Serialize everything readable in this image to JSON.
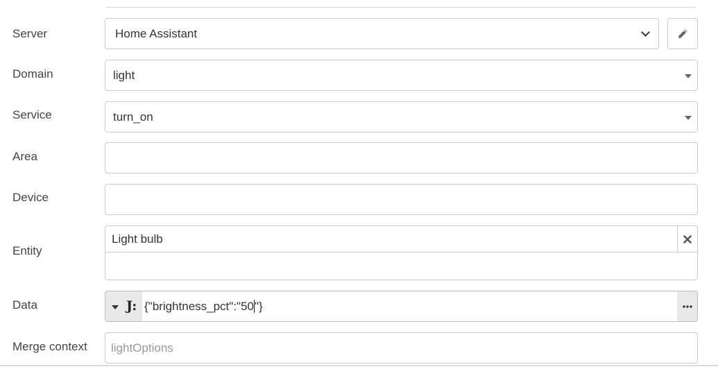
{
  "form": {
    "server": {
      "label": "Server",
      "value": "Home Assistant",
      "edit_icon": "pencil-icon"
    },
    "domain": {
      "label": "Domain",
      "value": "light"
    },
    "service": {
      "label": "Service",
      "value": "turn_on"
    },
    "area": {
      "label": "Area",
      "value": ""
    },
    "device": {
      "label": "Device",
      "value": ""
    },
    "entity": {
      "label": "Entity",
      "selected": [
        "Light bulb"
      ],
      "input_value": "",
      "remove_icon": "close-icon"
    },
    "data": {
      "label": "Data",
      "type_glyph": "J:",
      "value_before_cursor": "{\"brightness_pct\":\"50",
      "value_after_cursor": "\"}",
      "type_icon": "json-type-icon",
      "more_icon": "ellipsis-icon"
    },
    "merge_context": {
      "label": "Merge context",
      "placeholder": "lightOptions"
    }
  },
  "colors": {
    "border": "#cccccc",
    "focus_border": "#a8c1e0",
    "button_bg": "#e9e9e9",
    "label_text": "#444444"
  }
}
